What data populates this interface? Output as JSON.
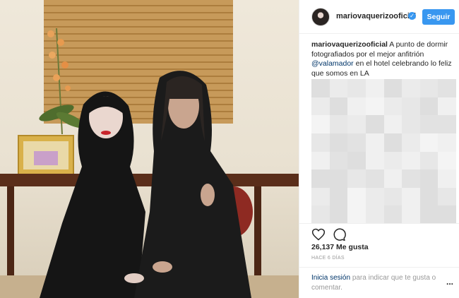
{
  "post": {
    "username": "mariovaquerizooficial",
    "verified_badge": "✓",
    "follow_label": "Seguir"
  },
  "caption": {
    "user": "mariovaquerizooficial",
    "text_1": "A punto de dormir fotografiados por el mejor anfitrión",
    "mention": "@valamador",
    "text_2": "en el hotel celebrando lo feliz que somos en LA"
  },
  "actions": {
    "like_icon": "heart-icon",
    "comment_icon": "comment-icon"
  },
  "likes": "26,137 Me gusta",
  "time_ago": "HACE 6 DÍAS",
  "footer": {
    "login_link": "Inicia sesión",
    "login_text": "para indicar que te gusta o comentar.",
    "more_label": "..."
  },
  "colors": {
    "accent": "#3897f0",
    "link": "#003569",
    "muted": "#999999",
    "border": "#efefef"
  }
}
